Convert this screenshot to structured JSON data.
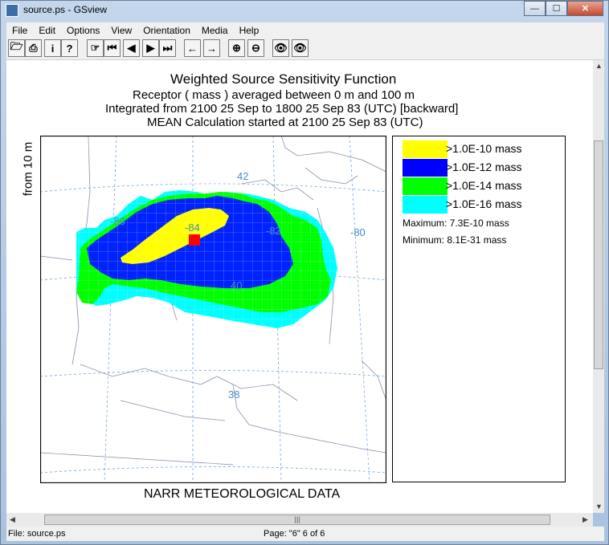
{
  "window": {
    "title": "source.ps - GSview"
  },
  "menu": [
    "File",
    "Edit",
    "Options",
    "View",
    "Orientation",
    "Media",
    "Help"
  ],
  "plot": {
    "title": "Weighted Source Sensitivity Function",
    "line1": "Receptor   ( mass  ) averaged between      0 m and    100 m",
    "line2": "Integrated from 2100 25 Sep to 1800 25 Sep 83 (UTC) [backward]",
    "line3": "MEAN Calculation started at 2100 25 Sep 83 (UTC)",
    "ylabel": "from    10 m",
    "xlabel": "NARR METEOROLOGICAL DATA",
    "map_labels": {
      "lat42": "42",
      "lat40": "40",
      "lat38": "38",
      "lon86": "-86",
      "lon84": "-84",
      "lon82": "-82",
      "lon80": "-80"
    }
  },
  "legend": {
    "items": [
      {
        "label": ">1.0E-10  mass",
        "color": "#ffff00"
      },
      {
        "label": ">1.0E-12  mass",
        "color": "#0000ff"
      },
      {
        "label": ">1.0E-14  mass",
        "color": "#00ff00"
      },
      {
        "label": ">1.0E-16  mass",
        "color": "#00ffff"
      }
    ],
    "maximum": "Maximum: 7.3E-10  mass",
    "minimum": "Minimum: 8.1E-31  mass"
  },
  "status": {
    "file": "File: source.ps",
    "page": "Page: \"6\"  6 of 6"
  }
}
